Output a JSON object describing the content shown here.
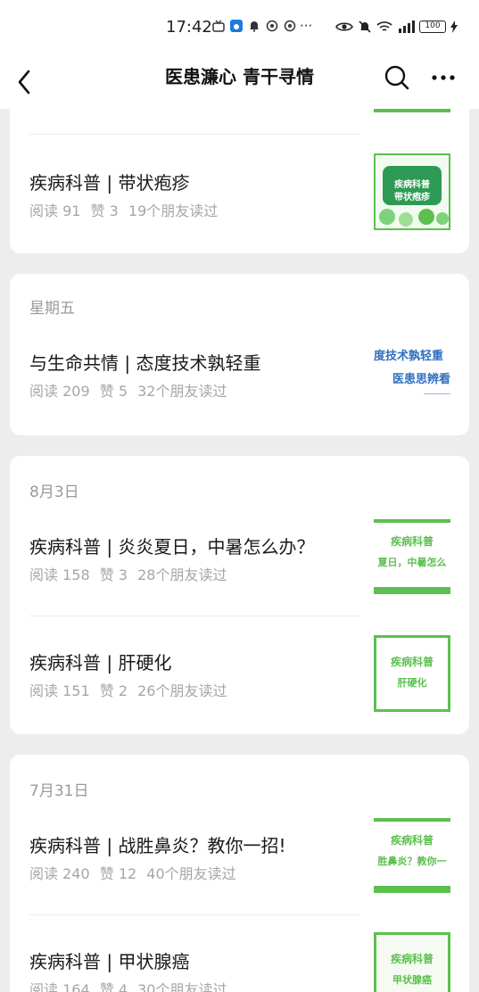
{
  "status_bar": {
    "time": "17:42",
    "more": "···",
    "battery": "100",
    "network": "4G"
  },
  "nav": {
    "title": "医患濂心 青干寻情"
  },
  "colors": {
    "accent_green": "#5cc04f",
    "thumb_blue": "#2f6fc0",
    "bg": "#ededed"
  },
  "groups": [
    {
      "date": "",
      "articles": [
        {
          "title": "疾病科普 | 带状疱疹",
          "reads": "阅读 91",
          "likes": "赞 3",
          "friends": "19个朋友读过",
          "thumb_line1": "疾病科普",
          "thumb_line2": "带状疱疹"
        }
      ]
    },
    {
      "date": "星期五",
      "articles": [
        {
          "title": "与生命共情 | 态度技术孰轻重",
          "reads": "阅读 209",
          "likes": "赞 5",
          "friends": "32个朋友读过",
          "thumb_line1": "度技术孰轻重",
          "thumb_line2": "医患思辨看"
        }
      ]
    },
    {
      "date": "8月3日",
      "articles": [
        {
          "title": "疾病科普 | 炎炎夏日，中暑怎么办？",
          "reads": "阅读 158",
          "likes": "赞 3",
          "friends": "28个朋友读过",
          "thumb_line1": "疾病科普",
          "thumb_line2": "夏日，中暑怎么"
        },
        {
          "title": "疾病科普 | 肝硬化",
          "reads": "阅读 151",
          "likes": "赞 2",
          "friends": "26个朋友读过",
          "thumb_line1": "疾病科普",
          "thumb_line2": "肝硬化"
        }
      ]
    },
    {
      "date": "7月31日",
      "articles": [
        {
          "title": "疾病科普 | 战胜鼻炎？教你一招!",
          "reads": "阅读 240",
          "likes": "赞 12",
          "friends": "40个朋友读过",
          "thumb_line1": "疾病科普",
          "thumb_line2": "胜鼻炎？教你一"
        },
        {
          "title": "疾病科普 | 甲状腺癌",
          "reads": "阅读 164",
          "likes": "赞 4",
          "friends": "30个朋友读过",
          "thumb_line1": "疾病科普",
          "thumb_line2": "甲状腺癌"
        }
      ]
    }
  ]
}
